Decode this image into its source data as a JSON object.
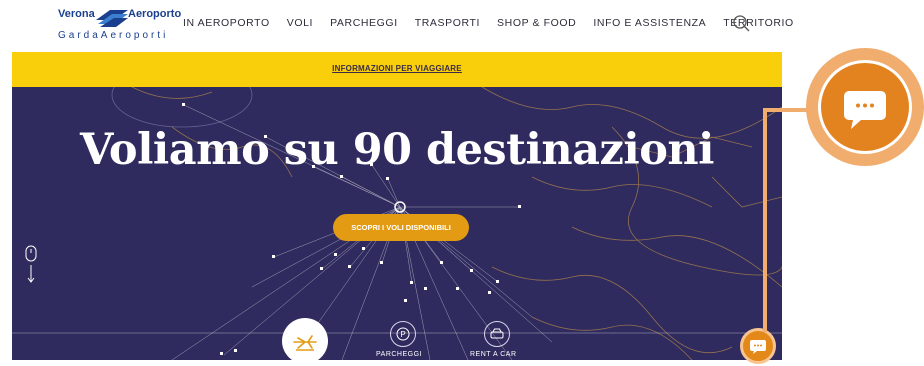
{
  "header": {
    "logo": {
      "word1": "Verona",
      "word2": "Aeroporto",
      "word3": "GardaAeroporti"
    },
    "nav": [
      "IN AEROPORTO",
      "VOLI",
      "PARCHEGGI",
      "TRASPORTI",
      "SHOP & FOOD",
      "INFO E ASSISTENZA",
      "TERRITORIO"
    ],
    "search_icon": "search-icon"
  },
  "banner": {
    "link": "INFORMAZIONI PER VIAGGIARE",
    "color": "#f9cf0b"
  },
  "hero": {
    "headline": "Voliamo su 90 destinazioni",
    "cta": "SCOPRI I VOLI DISPONIBILI",
    "background": "#2f2b5e",
    "accent": "#e39b13"
  },
  "quicklinks": [
    {
      "icon": "plane-icon",
      "label": ""
    },
    {
      "icon": "parking-icon",
      "label": "PARCHEGGI"
    },
    {
      "icon": "car-rental-icon",
      "label": "RENT A CAR"
    }
  ],
  "chat": {
    "icon": "chat-bubble-icon",
    "color": "#e3891a"
  }
}
